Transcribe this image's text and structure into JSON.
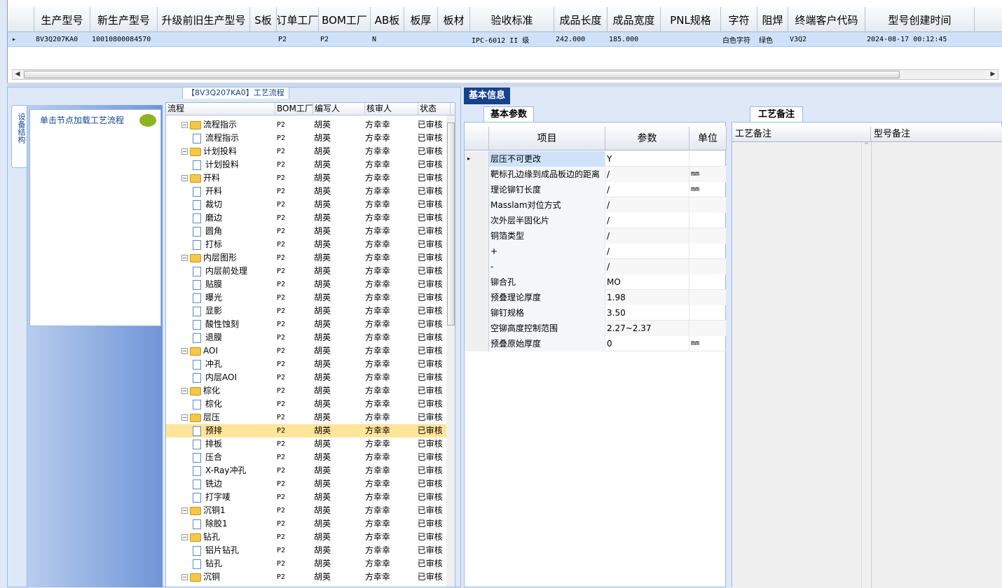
{
  "top_grid": {
    "headers": [
      "生产型号",
      "新生产型号",
      "升级前旧生产型号",
      "S板",
      "订单工厂",
      "BOM工厂",
      "AB板",
      "板厚",
      "板材",
      "验收标准",
      "成品长度",
      "成品宽度",
      "PNL规格",
      "字符",
      "阻焊",
      "终端客户代码",
      "型号创建时间"
    ],
    "row": [
      "8V3Q207KA0",
      "10010800084570",
      "",
      "",
      "P2",
      "P2",
      "N",
      "",
      "",
      "IPC-6012 II 级",
      "242.000",
      "185.000",
      "",
      "白色字符",
      "绿色",
      "V3Q2",
      "2024-08-17 00:12:45"
    ]
  },
  "left": {
    "vertical_tab": "设备结构",
    "hint": "单击节点加载工艺流程",
    "flow_title": "【8V3Q207KA0】工艺流程"
  },
  "tree": {
    "headers": [
      "流程",
      "BOM工厂",
      "编写人",
      "核审人",
      "状态"
    ],
    "rows": [
      {
        "name": "流程指示",
        "level": 0,
        "bom": "P2",
        "author": "胡英",
        "reviewer": "方幸幸",
        "status": "已审核"
      },
      {
        "name": "流程指示",
        "level": 1,
        "bom": "P2",
        "author": "胡英",
        "reviewer": "方幸幸",
        "status": "已审核"
      },
      {
        "name": "计划投料",
        "level": 0,
        "bom": "P2",
        "author": "胡英",
        "reviewer": "方幸幸",
        "status": "已审核"
      },
      {
        "name": "计划投料",
        "level": 1,
        "bom": "P2",
        "author": "胡英",
        "reviewer": "方幸幸",
        "status": "已审核"
      },
      {
        "name": "开料",
        "level": 0,
        "bom": "P2",
        "author": "胡英",
        "reviewer": "方幸幸",
        "status": "已审核"
      },
      {
        "name": "开料",
        "level": 1,
        "bom": "P2",
        "author": "胡英",
        "reviewer": "方幸幸",
        "status": "已审核"
      },
      {
        "name": "裁切",
        "level": 1,
        "bom": "P2",
        "author": "胡英",
        "reviewer": "方幸幸",
        "status": "已审核"
      },
      {
        "name": "磨边",
        "level": 1,
        "bom": "P2",
        "author": "胡英",
        "reviewer": "方幸幸",
        "status": "已审核"
      },
      {
        "name": "圆角",
        "level": 1,
        "bom": "P2",
        "author": "胡英",
        "reviewer": "方幸幸",
        "status": "已审核"
      },
      {
        "name": "打标",
        "level": 1,
        "bom": "P2",
        "author": "胡英",
        "reviewer": "方幸幸",
        "status": "已审核"
      },
      {
        "name": "内层图形",
        "level": 0,
        "bom": "P2",
        "author": "胡英",
        "reviewer": "方幸幸",
        "status": "已审核"
      },
      {
        "name": "内层前处理",
        "level": 1,
        "bom": "P2",
        "author": "胡英",
        "reviewer": "方幸幸",
        "status": "已审核"
      },
      {
        "name": "贴膜",
        "level": 1,
        "bom": "P2",
        "author": "胡英",
        "reviewer": "方幸幸",
        "status": "已审核"
      },
      {
        "name": "曝光",
        "level": 1,
        "bom": "P2",
        "author": "胡英",
        "reviewer": "方幸幸",
        "status": "已审核"
      },
      {
        "name": "显影",
        "level": 1,
        "bom": "P2",
        "author": "胡英",
        "reviewer": "方幸幸",
        "status": "已审核"
      },
      {
        "name": "酸性蚀刻",
        "level": 1,
        "bom": "P2",
        "author": "胡英",
        "reviewer": "方幸幸",
        "status": "已审核"
      },
      {
        "name": "退膜",
        "level": 1,
        "bom": "P2",
        "author": "胡英",
        "reviewer": "方幸幸",
        "status": "已审核"
      },
      {
        "name": "AOI",
        "level": 0,
        "bom": "P2",
        "author": "胡英",
        "reviewer": "方幸幸",
        "status": "已审核"
      },
      {
        "name": "冲孔",
        "level": 1,
        "bom": "P2",
        "author": "胡英",
        "reviewer": "方幸幸",
        "status": "已审核"
      },
      {
        "name": "内层AOI",
        "level": 1,
        "bom": "P2",
        "author": "胡英",
        "reviewer": "方幸幸",
        "status": "已审核"
      },
      {
        "name": "棕化",
        "level": 0,
        "bom": "P2",
        "author": "胡英",
        "reviewer": "方幸幸",
        "status": "已审核"
      },
      {
        "name": "棕化",
        "level": 1,
        "bom": "P2",
        "author": "胡英",
        "reviewer": "方幸幸",
        "status": "已审核"
      },
      {
        "name": "层压",
        "level": 0,
        "bom": "P2",
        "author": "胡英",
        "reviewer": "方幸幸",
        "status": "已审核"
      },
      {
        "name": "预排",
        "level": 1,
        "bom": "P2",
        "author": "胡英",
        "reviewer": "方幸幸",
        "status": "已审核",
        "selected": true
      },
      {
        "name": "排板",
        "level": 1,
        "bom": "P2",
        "author": "胡英",
        "reviewer": "方幸幸",
        "status": "已审核"
      },
      {
        "name": "压合",
        "level": 1,
        "bom": "P2",
        "author": "胡英",
        "reviewer": "方幸幸",
        "status": "已审核"
      },
      {
        "name": "X-Ray冲孔",
        "level": 1,
        "bom": "P2",
        "author": "胡英",
        "reviewer": "方幸幸",
        "status": "已审核"
      },
      {
        "name": "铣边",
        "level": 1,
        "bom": "P2",
        "author": "胡英",
        "reviewer": "方幸幸",
        "status": "已审核"
      },
      {
        "name": "打字唛",
        "level": 1,
        "bom": "P2",
        "author": "胡英",
        "reviewer": "方幸幸",
        "status": "已审核"
      },
      {
        "name": "沉铜1",
        "level": 0,
        "bom": "P2",
        "author": "胡英",
        "reviewer": "方幸幸",
        "status": "已审核"
      },
      {
        "name": "除胶1",
        "level": 1,
        "bom": "P2",
        "author": "胡英",
        "reviewer": "方幸幸",
        "status": "已审核"
      },
      {
        "name": "钻孔",
        "level": 0,
        "bom": "P2",
        "author": "胡英",
        "reviewer": "方幸幸",
        "status": "已审核"
      },
      {
        "name": "铝片钻孔",
        "level": 1,
        "bom": "P2",
        "author": "胡英",
        "reviewer": "方幸幸",
        "status": "已审核"
      },
      {
        "name": "钻孔",
        "level": 1,
        "bom": "P2",
        "author": "胡英",
        "reviewer": "方幸幸",
        "status": "已审核"
      },
      {
        "name": "沉铜",
        "level": 0,
        "bom": "P2",
        "author": "胡英",
        "reviewer": "方幸幸",
        "status": "已审核"
      }
    ]
  },
  "basic_info": {
    "tab": "基本信息",
    "params_tab": "基本参数",
    "remarks_tab": "工艺备注",
    "param_headers": [
      "项目",
      "参数",
      "单位"
    ],
    "params": [
      {
        "item": "层压不可更改",
        "value": "Y",
        "unit": ""
      },
      {
        "item": "靶标孔边缘到成品板边的距离",
        "value": "/",
        "unit": "mm"
      },
      {
        "item": "理论铆钉长度",
        "value": "/",
        "unit": "mm"
      },
      {
        "item": "Masslam对位方式",
        "value": "/",
        "unit": ""
      },
      {
        "item": "次外层半固化片",
        "value": "/",
        "unit": ""
      },
      {
        "item": "铜箔类型",
        "value": "/",
        "unit": ""
      },
      {
        "item": "+",
        "value": "/",
        "unit": ""
      },
      {
        "item": "-",
        "value": "/",
        "unit": ""
      },
      {
        "item": "铆合孔",
        "value": "MO",
        "unit": ""
      },
      {
        "item": "预叠理论厚度",
        "value": "1.98",
        "unit": ""
      },
      {
        "item": "铆钉规格",
        "value": "3.50",
        "unit": ""
      },
      {
        "item": "空铆高度控制范围",
        "value": "2.27~2.37",
        "unit": ""
      },
      {
        "item": "预叠原始厚度",
        "value": "0",
        "unit": "mm"
      }
    ],
    "remark_headers": [
      "工艺备注",
      "型号备注"
    ]
  }
}
